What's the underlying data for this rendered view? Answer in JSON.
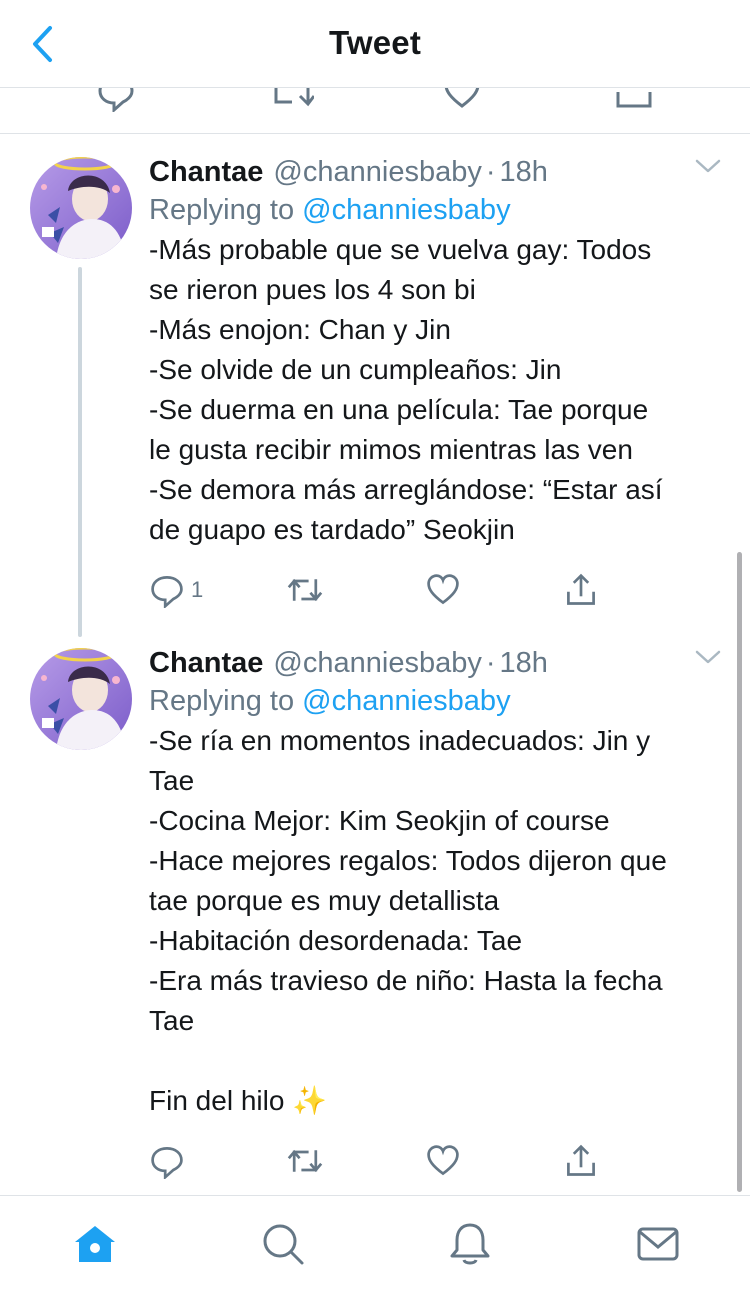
{
  "header": {
    "title": "Tweet",
    "back_icon": "chevron-left-icon"
  },
  "colors": {
    "accent": "#1da1f2",
    "secondary_text": "#657786",
    "divider": "#dfe3e7"
  },
  "tweets": [
    {
      "name": "Chantae",
      "handle": "@channiesbaby",
      "time": "18h",
      "replying_prefix": "Replying to",
      "replying_to": "@channiesbaby",
      "lines": [
        "-Más probable que se vuelva gay: Todos",
        "se rieron pues los 4 son bi",
        "-Más enojon: Chan y Jin",
        "-Se olvide de un cumpleaños: Jin",
        "-Se duerma en una película: Tae porque",
        "le gusta recibir mimos mientras las ven",
        "-Se demora más arreglándose: “Estar así",
        "de guapo es tardado” Seokjin"
      ],
      "reply_count": "1"
    },
    {
      "name": "Chantae",
      "handle": "@channiesbaby",
      "time": "18h",
      "replying_prefix": "Replying to",
      "replying_to": "@channiesbaby",
      "lines": [
        "-Se ría en momentos inadecuados: Jin y",
        "Tae",
        "-Cocina Mejor: Kim Seokjin of course",
        "-Hace mejores regalos: Todos dijeron que",
        "tae porque es muy detallista",
        "-Habitación desordenada: Tae",
        "-Era más travieso de niño: Hasta la fecha",
        "Tae",
        "",
        "Fin del hilo"
      ],
      "sparkle": "✨",
      "reply_count": ""
    }
  ],
  "tabs": [
    "home-icon",
    "search-icon",
    "notifications-icon",
    "messages-icon"
  ]
}
